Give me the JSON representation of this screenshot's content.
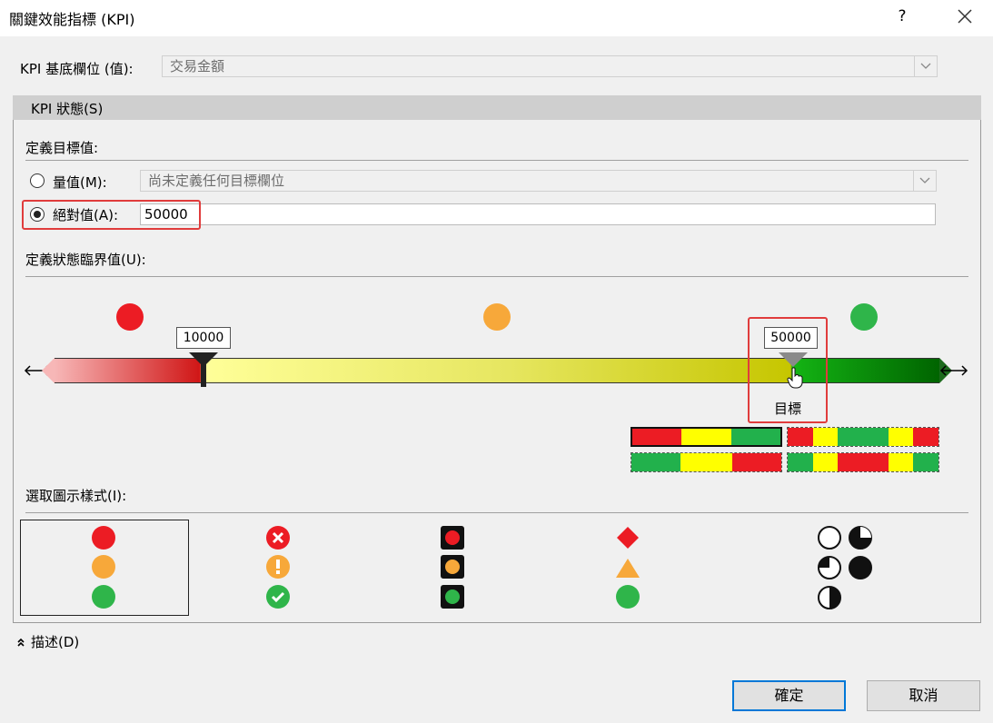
{
  "window": {
    "title": "關鍵效能指標 (KPI)",
    "help": "?"
  },
  "base_field": {
    "label": "KPI 基底欄位 (值):",
    "value": "交易金額"
  },
  "status": {
    "header": "KPI 狀態(S)",
    "define_target_label": "定義目標值:",
    "measure_option_label": "量值(M):",
    "measure_combo_value": "尚未定義任何目標欄位",
    "absolute_option_label": "絕對值(A):",
    "absolute_value": "50000",
    "threshold_label": "定義狀態臨界值(U):",
    "threshold_low": "10000",
    "threshold_target": "50000",
    "target_caption": "目標"
  },
  "colors": {
    "red": "#ec1c24",
    "orange": "#f7a83a",
    "green": "#2fb54a",
    "accent": "#e03c3c"
  },
  "icon_style_label": "選取圖示樣式(I):",
  "description_toggle": "描述(D)",
  "buttons": {
    "ok": "確定",
    "cancel": "取消"
  }
}
